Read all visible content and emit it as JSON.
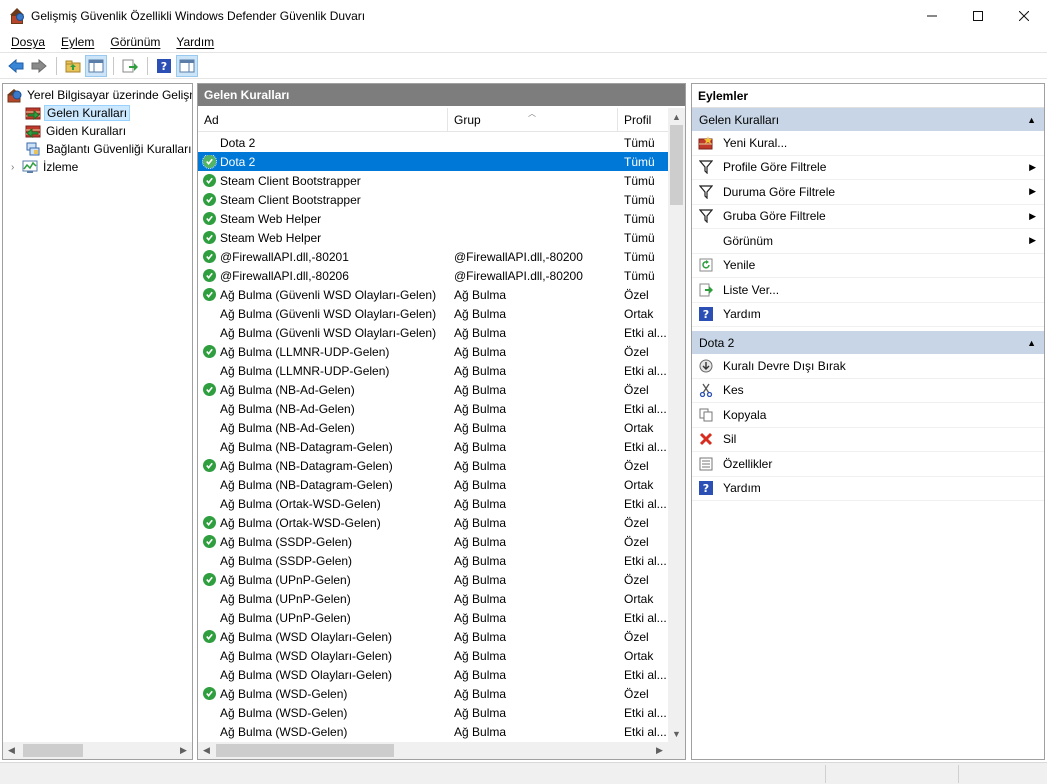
{
  "window": {
    "title": "Gelişmiş Güvenlik Özellikli Windows Defender Güvenlik Duvarı",
    "minimize": "—",
    "maximize": "☐",
    "close": "✕"
  },
  "menu": [
    "Dosya",
    "Eylem",
    "Görünüm",
    "Yardım"
  ],
  "tree": {
    "root": "Yerel Bilgisayar üzerinde Gelişmiş",
    "items": [
      {
        "label": "Gelen Kuralları",
        "selected": true
      },
      {
        "label": "Giden Kuralları",
        "selected": false
      },
      {
        "label": "Bağlantı Güvenliği Kuralları",
        "selected": false
      },
      {
        "label": "İzleme",
        "selected": false
      }
    ]
  },
  "center": {
    "header": "Gelen Kuralları",
    "columns": {
      "name": "Ad",
      "group": "Grup",
      "profile": "Profil"
    },
    "rows": [
      {
        "name": "Dota 2",
        "group": "",
        "profile": "Tümü",
        "enabled": false,
        "selected": false
      },
      {
        "name": "Dota 2",
        "group": "",
        "profile": "Tümü",
        "enabled": true,
        "selected": true
      },
      {
        "name": "Steam Client Bootstrapper",
        "group": "",
        "profile": "Tümü",
        "enabled": true,
        "selected": false
      },
      {
        "name": "Steam Client Bootstrapper",
        "group": "",
        "profile": "Tümü",
        "enabled": true,
        "selected": false
      },
      {
        "name": "Steam Web Helper",
        "group": "",
        "profile": "Tümü",
        "enabled": true,
        "selected": false
      },
      {
        "name": "Steam Web Helper",
        "group": "",
        "profile": "Tümü",
        "enabled": true,
        "selected": false
      },
      {
        "name": "@FirewallAPI.dll,-80201",
        "group": "@FirewallAPI.dll,-80200",
        "profile": "Tümü",
        "enabled": true,
        "selected": false
      },
      {
        "name": "@FirewallAPI.dll,-80206",
        "group": "@FirewallAPI.dll,-80200",
        "profile": "Tümü",
        "enabled": true,
        "selected": false
      },
      {
        "name": "Ağ Bulma (Güvenli WSD Olayları-Gelen)",
        "group": "Ağ Bulma",
        "profile": "Özel",
        "enabled": true,
        "selected": false
      },
      {
        "name": "Ağ Bulma (Güvenli WSD Olayları-Gelen)",
        "group": "Ağ Bulma",
        "profile": "Ortak",
        "enabled": false,
        "selected": false
      },
      {
        "name": "Ağ Bulma (Güvenli WSD Olayları-Gelen)",
        "group": "Ağ Bulma",
        "profile": "Etki al...",
        "enabled": false,
        "selected": false
      },
      {
        "name": "Ağ Bulma (LLMNR-UDP-Gelen)",
        "group": "Ağ Bulma",
        "profile": "Özel",
        "enabled": true,
        "selected": false
      },
      {
        "name": "Ağ Bulma (LLMNR-UDP-Gelen)",
        "group": "Ağ Bulma",
        "profile": "Etki al...",
        "enabled": false,
        "selected": false
      },
      {
        "name": "Ağ Bulma (NB-Ad-Gelen)",
        "group": "Ağ Bulma",
        "profile": "Özel",
        "enabled": true,
        "selected": false
      },
      {
        "name": "Ağ Bulma (NB-Ad-Gelen)",
        "group": "Ağ Bulma",
        "profile": "Etki al...",
        "enabled": false,
        "selected": false
      },
      {
        "name": "Ağ Bulma (NB-Ad-Gelen)",
        "group": "Ağ Bulma",
        "profile": "Ortak",
        "enabled": false,
        "selected": false
      },
      {
        "name": "Ağ Bulma (NB-Datagram-Gelen)",
        "group": "Ağ Bulma",
        "profile": "Etki al...",
        "enabled": false,
        "selected": false
      },
      {
        "name": "Ağ Bulma (NB-Datagram-Gelen)",
        "group": "Ağ Bulma",
        "profile": "Özel",
        "enabled": true,
        "selected": false
      },
      {
        "name": "Ağ Bulma (NB-Datagram-Gelen)",
        "group": "Ağ Bulma",
        "profile": "Ortak",
        "enabled": false,
        "selected": false
      },
      {
        "name": "Ağ Bulma (Ortak-WSD-Gelen)",
        "group": "Ağ Bulma",
        "profile": "Etki al...",
        "enabled": false,
        "selected": false
      },
      {
        "name": "Ağ Bulma (Ortak-WSD-Gelen)",
        "group": "Ağ Bulma",
        "profile": "Özel",
        "enabled": true,
        "selected": false
      },
      {
        "name": "Ağ Bulma (SSDP-Gelen)",
        "group": "Ağ Bulma",
        "profile": "Özel",
        "enabled": true,
        "selected": false
      },
      {
        "name": "Ağ Bulma (SSDP-Gelen)",
        "group": "Ağ Bulma",
        "profile": "Etki al...",
        "enabled": false,
        "selected": false
      },
      {
        "name": "Ağ Bulma (UPnP-Gelen)",
        "group": "Ağ Bulma",
        "profile": "Özel",
        "enabled": true,
        "selected": false
      },
      {
        "name": "Ağ Bulma (UPnP-Gelen)",
        "group": "Ağ Bulma",
        "profile": "Ortak",
        "enabled": false,
        "selected": false
      },
      {
        "name": "Ağ Bulma (UPnP-Gelen)",
        "group": "Ağ Bulma",
        "profile": "Etki al...",
        "enabled": false,
        "selected": false
      },
      {
        "name": "Ağ Bulma (WSD Olayları-Gelen)",
        "group": "Ağ Bulma",
        "profile": "Özel",
        "enabled": true,
        "selected": false
      },
      {
        "name": "Ağ Bulma (WSD Olayları-Gelen)",
        "group": "Ağ Bulma",
        "profile": "Ortak",
        "enabled": false,
        "selected": false
      },
      {
        "name": "Ağ Bulma (WSD Olayları-Gelen)",
        "group": "Ağ Bulma",
        "profile": "Etki al...",
        "enabled": false,
        "selected": false
      },
      {
        "name": "Ağ Bulma (WSD-Gelen)",
        "group": "Ağ Bulma",
        "profile": "Özel",
        "enabled": true,
        "selected": false
      },
      {
        "name": "Ağ Bulma (WSD-Gelen)",
        "group": "Ağ Bulma",
        "profile": "Etki al...",
        "enabled": false,
        "selected": false
      },
      {
        "name": "Ağ Bulma (WSD-Gelen)",
        "group": "Ağ Bulma",
        "profile": "Etki al...",
        "enabled": false,
        "selected": false
      }
    ]
  },
  "actions": {
    "title": "Eylemler",
    "sections": [
      {
        "label": "Gelen Kuralları",
        "items": [
          {
            "label": "Yeni Kural...",
            "icon": "new-rule-icon",
            "submenu": false
          },
          {
            "label": "Profile Göre Filtrele",
            "icon": "filter-icon",
            "submenu": true
          },
          {
            "label": "Duruma Göre Filtrele",
            "icon": "filter-icon",
            "submenu": true
          },
          {
            "label": "Gruba Göre Filtrele",
            "icon": "filter-icon",
            "submenu": true
          },
          {
            "label": "Görünüm",
            "icon": "",
            "submenu": true
          },
          {
            "label": "Yenile",
            "icon": "refresh-icon",
            "submenu": false
          },
          {
            "label": "Liste Ver...",
            "icon": "export-icon",
            "submenu": false
          },
          {
            "label": "Yardım",
            "icon": "help-icon",
            "submenu": false
          }
        ]
      },
      {
        "label": "Dota 2",
        "items": [
          {
            "label": "Kuralı Devre Dışı Bırak",
            "icon": "disable-icon",
            "submenu": false
          },
          {
            "label": "Kes",
            "icon": "cut-icon",
            "submenu": false
          },
          {
            "label": "Kopyala",
            "icon": "copy-icon",
            "submenu": false
          },
          {
            "label": "Sil",
            "icon": "delete-icon",
            "submenu": false
          },
          {
            "label": "Özellikler",
            "icon": "properties-icon",
            "submenu": false
          },
          {
            "label": "Yardım",
            "icon": "help-icon",
            "submenu": false
          }
        ]
      }
    ]
  },
  "colors": {
    "selection": "#0078d7",
    "enabled_check": "#2e9e3e",
    "section_header": "#c7d5e6",
    "pane_header": "#7d7d7d"
  }
}
